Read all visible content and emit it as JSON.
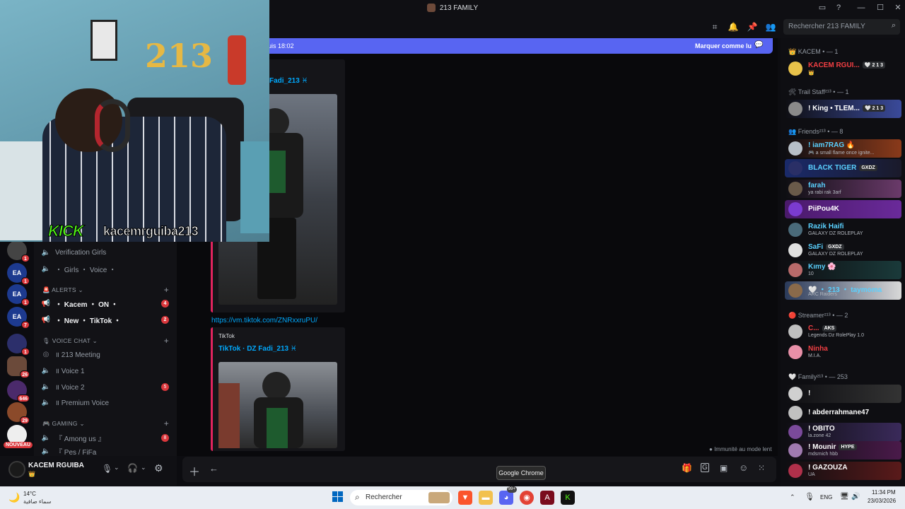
{
  "window": {
    "title": "213 FAMILY"
  },
  "header": {
    "search_placeholder": "Rechercher 213 FAMILY"
  },
  "chat": {
    "new_messages_text": "puis 18:02",
    "mark_read_label": "Marquer comme lu",
    "embed1_title": "Fadi_213 ♓",
    "link_url": "https://vm.tiktok.com/ZNRxxruPU/",
    "embed2_provider": "TikTok",
    "embed2_title": "TikTok · DZ Fadi_213 ♓",
    "slowmode_text": "Immunité au mode lent"
  },
  "channels": {
    "verification": "Verification Girls",
    "girls_voice": "・ Girls ・ Voice ・",
    "cat_alerts": "ALERTS",
    "kacem_on": "・ Kacem ・ ON ・",
    "kacem_on_badge": "4",
    "new_tiktok": "・ New ・ TikTok ・",
    "new_tiktok_badge": "2",
    "cat_voice": "VOICE CHAT",
    "meeting": "॥ 213 Meeting",
    "voice1": "॥ Voice 1",
    "voice2": "॥ Voice 2",
    "voice2_badge": "5",
    "premium": "॥ Premium Voice",
    "cat_gaming": "GAMING",
    "among": "『 Among us 』",
    "among_badge": "8",
    "pes": "『 Pes / FiFa"
  },
  "servers": {
    "badges": [
      "1",
      "1",
      "1",
      "7",
      "1",
      "26",
      "646",
      "29"
    ],
    "new_label": "NOUVEAU"
  },
  "user": {
    "name": "KACEM RGUIBA",
    "status": "👑"
  },
  "members": {
    "groups": [
      {
        "label": "KACEM",
        "count": "— 1"
      },
      {
        "label": "Trail Staff²¹³",
        "count": "— 1"
      },
      {
        "label": "Friends²¹³",
        "count": "— 8"
      },
      {
        "label": "Streamer²¹³",
        "count": "— 2"
      },
      {
        "label": "Family²¹³",
        "count": "— 253"
      }
    ],
    "list": [
      {
        "name": "KACEM RGUI...",
        "tag": "🤍 2 1 3",
        "sub": "👑",
        "color": "#f23f43"
      },
      {
        "name": "! King • TLEM...",
        "tag": "🤍 2 1 3",
        "sub": "",
        "color": "#ffffff"
      },
      {
        "name": "! iam7RAG 🔥",
        "tag": "",
        "sub": "🎮 a small flame once ignite...",
        "color": "#5ad1ff"
      },
      {
        "name": "BLACK TIGER",
        "tag": "GXDZ",
        "sub": "",
        "color": "#5ad1ff"
      },
      {
        "name": "farah",
        "tag": "",
        "sub": "ya rabi rak 3arf",
        "color": "#5ad1ff"
      },
      {
        "name": "PiiPou4K",
        "tag": "",
        "sub": "",
        "color": "#ffffff"
      },
      {
        "name": "Razik Haifi",
        "tag": "",
        "sub": "GALAXY DZ ROLEPLAY",
        "color": "#5ad1ff"
      },
      {
        "name": "SaFi",
        "tag": "GXDZ",
        "sub": "GALAXY DZ ROLEPLAY",
        "color": "#5ad1ff"
      },
      {
        "name": "Kımy 🌸",
        "tag": "",
        "sub": "10",
        "color": "#5ad1ff"
      },
      {
        "name": "🤍 ・ 213 ・ taymoma",
        "tag": "",
        "sub": "ARC Raiders",
        "color": "#5ad1ff"
      },
      {
        "name": "C...",
        "tag": "AKS",
        "sub": "Legends Dz RolePlay 1.0",
        "color": "#f23f43"
      },
      {
        "name": "Ninha",
        "tag": "",
        "sub": "M.I.A.",
        "color": "#f23f43"
      },
      {
        "name": "!",
        "tag": "",
        "sub": "",
        "color": "#ffffff"
      },
      {
        "name": "! abderrahmane47",
        "tag": "",
        "sub": "",
        "color": "#ffffff"
      },
      {
        "name": "! OBITO",
        "tag": "",
        "sub": "la.zone 42",
        "color": "#ffffff"
      },
      {
        "name": "! Mounir",
        "tag": "HYPE",
        "sub": "mdsrnich hbb",
        "color": "#ffffff"
      },
      {
        "name": "! GAZOUZA",
        "tag": "",
        "sub": "UA",
        "color": "#ffffff"
      }
    ]
  },
  "webcam": {
    "overlay_kick": "KICK",
    "overlay_user": "kacemrguiba213",
    "balloons": "213"
  },
  "taskbar": {
    "weather_temp": "14°C",
    "weather_desc": "سماء صافية",
    "search_label": "Rechercher",
    "tooltip": "Google Chrome",
    "lang": "ENG",
    "time": "11:34 PM",
    "date": "23/03/2026",
    "discord_badge": "99+"
  }
}
